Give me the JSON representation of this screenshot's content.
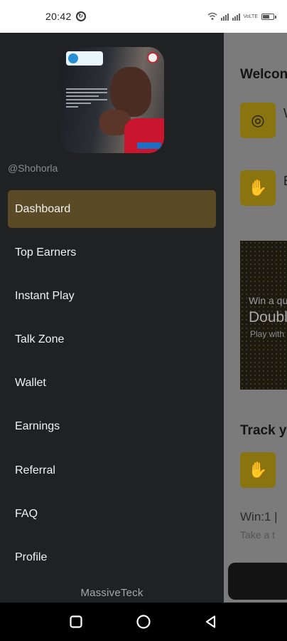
{
  "status_bar": {
    "time": "20:42",
    "network_label": "VoLTE"
  },
  "drawer": {
    "username": "@Shohorla",
    "menu": [
      {
        "label": "Dashboard",
        "active": true
      },
      {
        "label": "Top Earners",
        "active": false
      },
      {
        "label": "Instant Play",
        "active": false
      },
      {
        "label": "Talk Zone",
        "active": false
      },
      {
        "label": "Wallet",
        "active": false
      },
      {
        "label": "Earnings",
        "active": false
      },
      {
        "label": "Referral",
        "active": false
      },
      {
        "label": "FAQ",
        "active": false
      },
      {
        "label": "Profile",
        "active": false
      }
    ],
    "footer": "MassiveTeck",
    "active_color": "#5a4a26"
  },
  "background_app": {
    "welcome_title": "Welcon",
    "card_prefix_1": "W",
    "card_prefix_2": "E",
    "banner_line1": "Win a qu",
    "banner_line2": "Doubl",
    "banner_line3": "Play with",
    "track_title": "Track y",
    "win_text": "Win:1 |",
    "take_text": "Take a t",
    "accent_color": "#d4b200"
  },
  "nav_bar": {
    "buttons": [
      "recents-icon",
      "home-icon",
      "back-icon"
    ]
  }
}
